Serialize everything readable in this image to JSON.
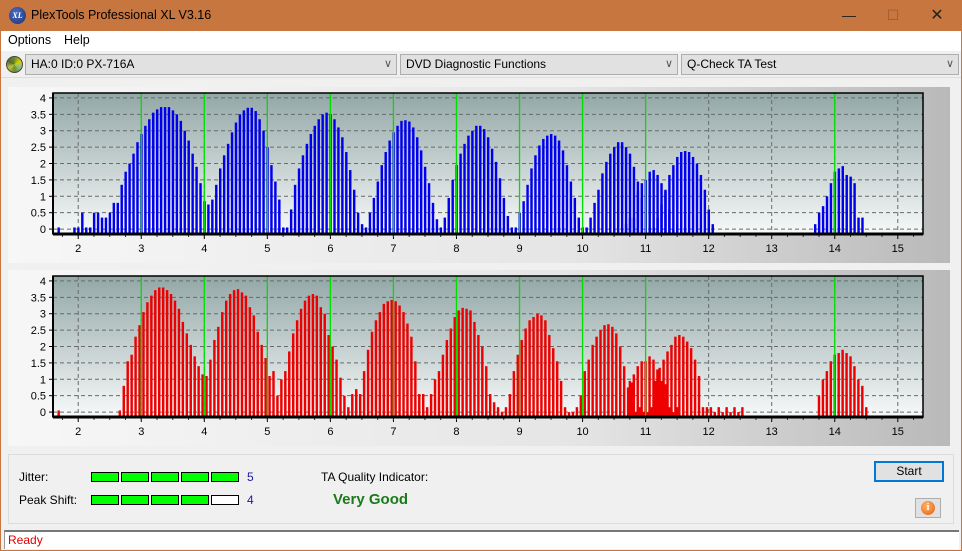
{
  "window": {
    "title": "PlexTools Professional XL V3.16",
    "icon": "xl-logo-icon",
    "min_glyph": "—",
    "max_glyph": "☐",
    "close_glyph": "✕"
  },
  "menu": [
    {
      "label": "Options"
    },
    {
      "label": "Help"
    }
  ],
  "toolbar": {
    "drive_icon": "disc-icon",
    "drive": "HA:0 ID:0  PX-716A",
    "function": "DVD Diagnostic Functions",
    "test": "Q-Check TA Test",
    "chevron": "∨"
  },
  "results": {
    "jitter_label": "Jitter:",
    "jitter_value": "5",
    "jitter_level": 5,
    "peak_shift_label": "Peak Shift:",
    "peak_shift_value": "4",
    "peak_shift_level": 4,
    "meter_max": 5,
    "ta_label": "TA Quality Indicator:",
    "ta_value": "Very Good",
    "colors": {
      "meter_on": "#00ff00",
      "quality": "#1a7a1a",
      "value": "#1a1aa0"
    }
  },
  "buttons": {
    "start": "Start",
    "info_glyph": "i"
  },
  "status": {
    "text": "Ready"
  },
  "chart_data": [
    {
      "type": "bar",
      "title": "",
      "name": "top-histogram",
      "color": "#0000ee",
      "marker_color": "#00e000",
      "xlabel": "",
      "ylabel": "",
      "xlim": [
        1.6,
        15.4
      ],
      "ylim": [
        -0.15,
        4.15
      ],
      "xticks": [
        2,
        3,
        4,
        5,
        6,
        7,
        8,
        9,
        10,
        11,
        12,
        13,
        14,
        15
      ],
      "yticks": [
        0,
        0.5,
        1,
        1.5,
        2,
        2.5,
        3,
        3.5,
        4
      ],
      "ytick_labels": [
        "0",
        "0.5",
        "1",
        "1.5",
        "2",
        "2.5",
        "3",
        "3.5",
        "4"
      ],
      "markers": [
        3,
        4,
        5,
        6,
        7,
        8,
        9,
        10,
        11,
        14
      ],
      "grid": true,
      "bar_step": 0.0625,
      "segments": [
        {
          "start": 1.69,
          "values": [
            0.05
          ]
        },
        {
          "start": 1.94,
          "values": [
            0.05,
            0.05,
            0.5,
            0.05,
            0.05,
            0.5,
            0.5,
            0.35,
            0.35,
            0.5,
            0.8,
            0.8,
            1.35,
            1.75,
            2.0,
            2.3,
            2.65,
            2.9,
            3.15,
            3.35,
            3.55,
            3.65,
            3.72,
            3.72,
            3.72,
            3.62,
            3.5,
            3.3,
            3.0,
            2.7,
            2.3,
            1.9,
            1.4,
            0.85,
            0.75,
            0.9,
            1.35,
            1.85,
            2.25,
            2.6,
            2.95,
            3.25,
            3.5,
            3.62,
            3.7,
            3.7,
            3.6,
            3.35,
            3.0,
            2.5,
            1.95,
            1.45,
            0.9,
            0.05,
            0.05,
            0.6,
            1.35,
            1.85,
            2.25,
            2.6,
            2.9,
            3.15,
            3.35,
            3.5,
            3.55,
            3.5,
            3.35,
            3.1,
            2.8,
            2.35,
            1.8,
            1.2,
            0.5,
            0.15,
            0.05,
            0.5,
            0.95,
            1.45,
            1.95,
            2.35,
            2.7,
            2.95,
            3.15,
            3.3,
            3.32,
            3.28,
            3.1,
            2.8,
            2.4,
            1.9,
            1.4,
            0.8,
            0.3,
            0.05,
            0.35,
            0.95,
            1.5,
            1.95,
            2.3,
            2.6,
            2.85,
            3.0,
            3.15,
            3.15,
            3.05,
            2.8,
            2.45,
            2.05,
            1.55,
            0.95,
            0.4,
            0.05,
            0.05,
            0.5,
            0.85,
            1.35,
            1.85,
            2.25,
            2.55,
            2.75,
            2.85,
            2.9,
            2.85,
            2.7,
            2.4,
            1.95,
            1.45,
            0.95,
            0.35,
            0.05,
            0.05,
            0.35,
            0.8,
            1.2,
            1.7,
            2.05,
            2.3,
            2.5,
            2.65,
            2.65,
            2.5,
            2.3,
            1.9,
            1.45,
            0.95,
            0.35,
            0.05,
            0.05,
            0.35,
            0.75,
            1.2,
            1.65,
            1.95,
            2.2,
            2.35,
            2.38,
            2.35,
            2.2,
            2.0,
            1.65,
            1.2,
            0.6,
            0.15
          ]
        },
        {
          "start": 10.69,
          "values": [
            0.15,
            0.35,
            0.35,
            1.15,
            1.4,
            1.5,
            1.75,
            1.8,
            1.65,
            1.4,
            1.15,
            0.6,
            0.0,
            0.15
          ]
        },
        {
          "start": 13.69,
          "values": [
            0.15,
            0.5,
            0.7,
            1.0,
            1.4,
            1.75,
            1.85,
            1.92,
            1.65,
            1.6,
            1.4,
            0.35,
            0.35
          ]
        }
      ]
    },
    {
      "type": "bar",
      "title": "",
      "name": "bottom-histogram",
      "color": "#ee0000",
      "marker_color": "#00e000",
      "xlabel": "",
      "ylabel": "",
      "xlim": [
        1.6,
        15.4
      ],
      "ylim": [
        -0.15,
        4.15
      ],
      "xticks": [
        2,
        3,
        4,
        5,
        6,
        7,
        8,
        9,
        10,
        11,
        12,
        13,
        14,
        15
      ],
      "yticks": [
        0,
        0.5,
        1,
        1.5,
        2,
        2.5,
        3,
        3.5,
        4
      ],
      "ytick_labels": [
        "0",
        "0.5",
        "1",
        "1.5",
        "2",
        "2.5",
        "3",
        "3.5",
        "4"
      ],
      "markers": [
        3,
        4,
        5,
        6,
        7,
        8,
        9,
        10,
        11,
        14
      ],
      "grid": true,
      "bar_step": 0.0625,
      "segments": [
        {
          "start": 1.69,
          "values": [
            0.05
          ]
        },
        {
          "start": 2.66,
          "values": [
            0.05,
            0.8,
            1.55,
            1.75,
            2.3,
            2.65,
            3.05,
            3.35,
            3.55,
            3.72,
            3.8,
            3.8,
            3.72,
            3.6,
            3.4,
            3.15,
            2.75,
            2.4,
            2.05,
            1.7,
            1.4,
            1.15,
            1.1,
            1.6,
            2.2,
            2.6,
            3.05,
            3.4,
            3.6,
            3.72,
            3.75,
            3.65,
            3.55,
            3.2,
            2.95,
            2.45,
            2.05,
            1.65,
            1.1,
            1.25,
            0.5,
            1.0,
            1.25,
            1.85,
            2.4,
            2.8,
            3.15,
            3.4,
            3.55,
            3.6,
            3.55,
            3.2,
            3.0,
            2.35,
            2.0,
            1.6,
            1.05,
            0.5,
            0.15,
            0.55,
            0.7,
            0.55,
            1.25,
            1.9,
            2.45,
            2.8,
            3.05,
            3.3,
            3.38,
            3.42,
            3.38,
            3.25,
            3.05,
            2.7,
            2.3,
            1.55,
            0.55,
            0.55,
            0.15,
            0.55,
            1.0,
            1.25,
            1.75,
            2.2,
            2.55,
            2.9,
            3.1,
            3.18,
            3.15,
            3.1,
            2.75,
            2.35,
            2.0,
            1.4,
            0.55,
            0.3,
            0.15,
            0.0,
            0.15,
            0.55,
            1.25,
            1.75,
            2.2,
            2.55,
            2.8,
            2.9,
            3.0,
            2.95,
            2.8,
            2.35,
            1.95,
            1.55,
            0.95,
            0.15,
            0.0,
            0.0,
            0.15,
            0.5,
            1.25,
            1.6,
            2.05,
            2.3,
            2.5,
            2.65,
            2.68,
            2.6,
            2.4,
            2.0,
            1.4,
            0.75,
            0.9,
            0.0,
            0.15,
            0.0,
            0.0,
            0.15,
            0.95,
            1.35,
            1.6,
            1.85,
            2.05,
            2.3,
            2.35,
            2.3,
            2.15,
            1.95,
            1.6,
            1.1,
            0.15,
            0.15,
            0.15,
            0.0,
            0.15,
            0.0,
            0.15,
            0.0,
            0.15,
            0.0,
            0.15
          ]
        },
        {
          "start": 10.75,
          "values": [
            0.95,
            1.15,
            1.4,
            1.55,
            1.55,
            1.7,
            1.6,
            1.3,
            0.95,
            0.85,
            0.15,
            0.0,
            0.15
          ]
        },
        {
          "start": 13.75,
          "values": [
            0.5,
            1.0,
            1.25,
            1.55,
            1.75,
            1.8,
            1.9,
            1.8,
            1.7,
            1.4,
            1.0,
            0.8,
            0.15
          ]
        }
      ]
    }
  ]
}
